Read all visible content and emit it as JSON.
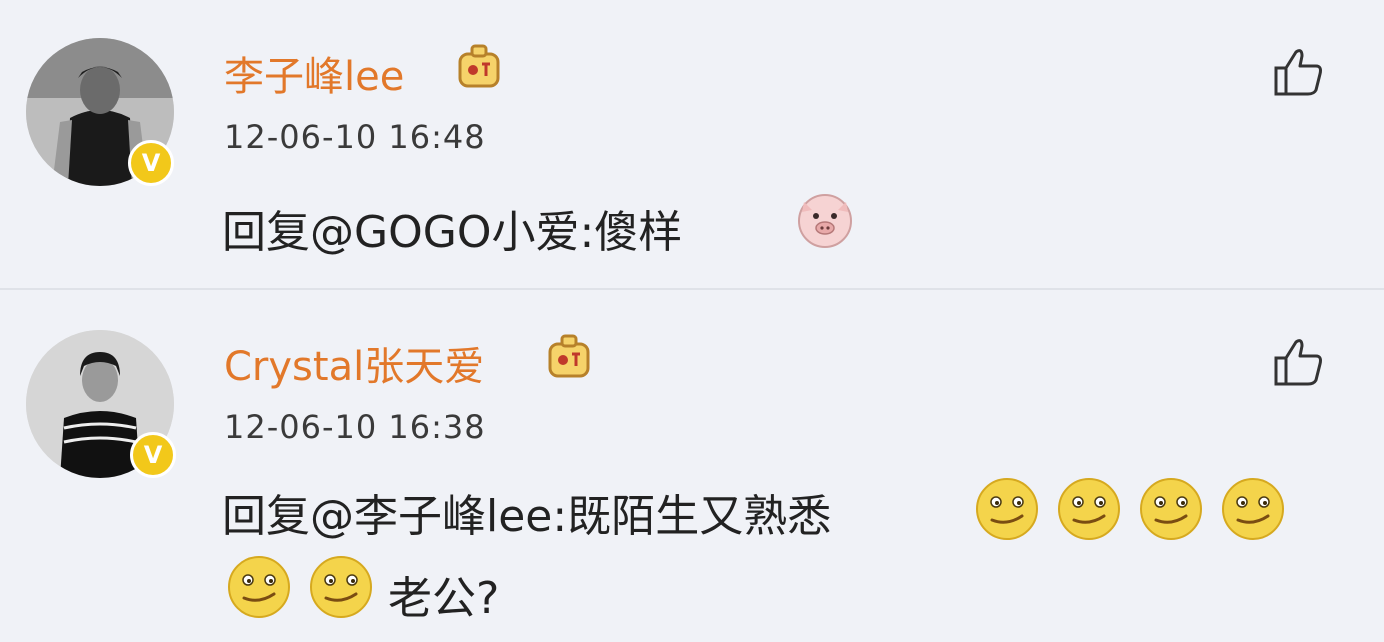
{
  "comments": [
    {
      "username": "李子峰lee",
      "timestamp": "12-06-10 16:48",
      "reply_prefix": "回复",
      "mention": "@GOGO小爱",
      "separator": ":",
      "body": "傻样",
      "emoji": [
        "pig-emoji-icon"
      ]
    },
    {
      "username": "Crystal张天爱",
      "timestamp": "12-06-10 16:38",
      "reply_prefix": "回复",
      "mention": "@李子峰lee",
      "separator": ":",
      "body": "既陌生又熟悉",
      "body_tail": "老公?",
      "emoji": [
        "smirk-emoji-icon",
        "smirk-emoji-icon",
        "smirk-emoji-icon",
        "smirk-emoji-icon",
        "smirk-emoji-icon",
        "smirk-emoji-icon"
      ]
    }
  ],
  "colors": {
    "username": "#e2782a",
    "badge": "#f2c81a",
    "background": "#f0f2f7"
  },
  "icons": [
    "avatar",
    "verified-badge-icon",
    "crown-badge-icon",
    "like-thumb-icon"
  ]
}
